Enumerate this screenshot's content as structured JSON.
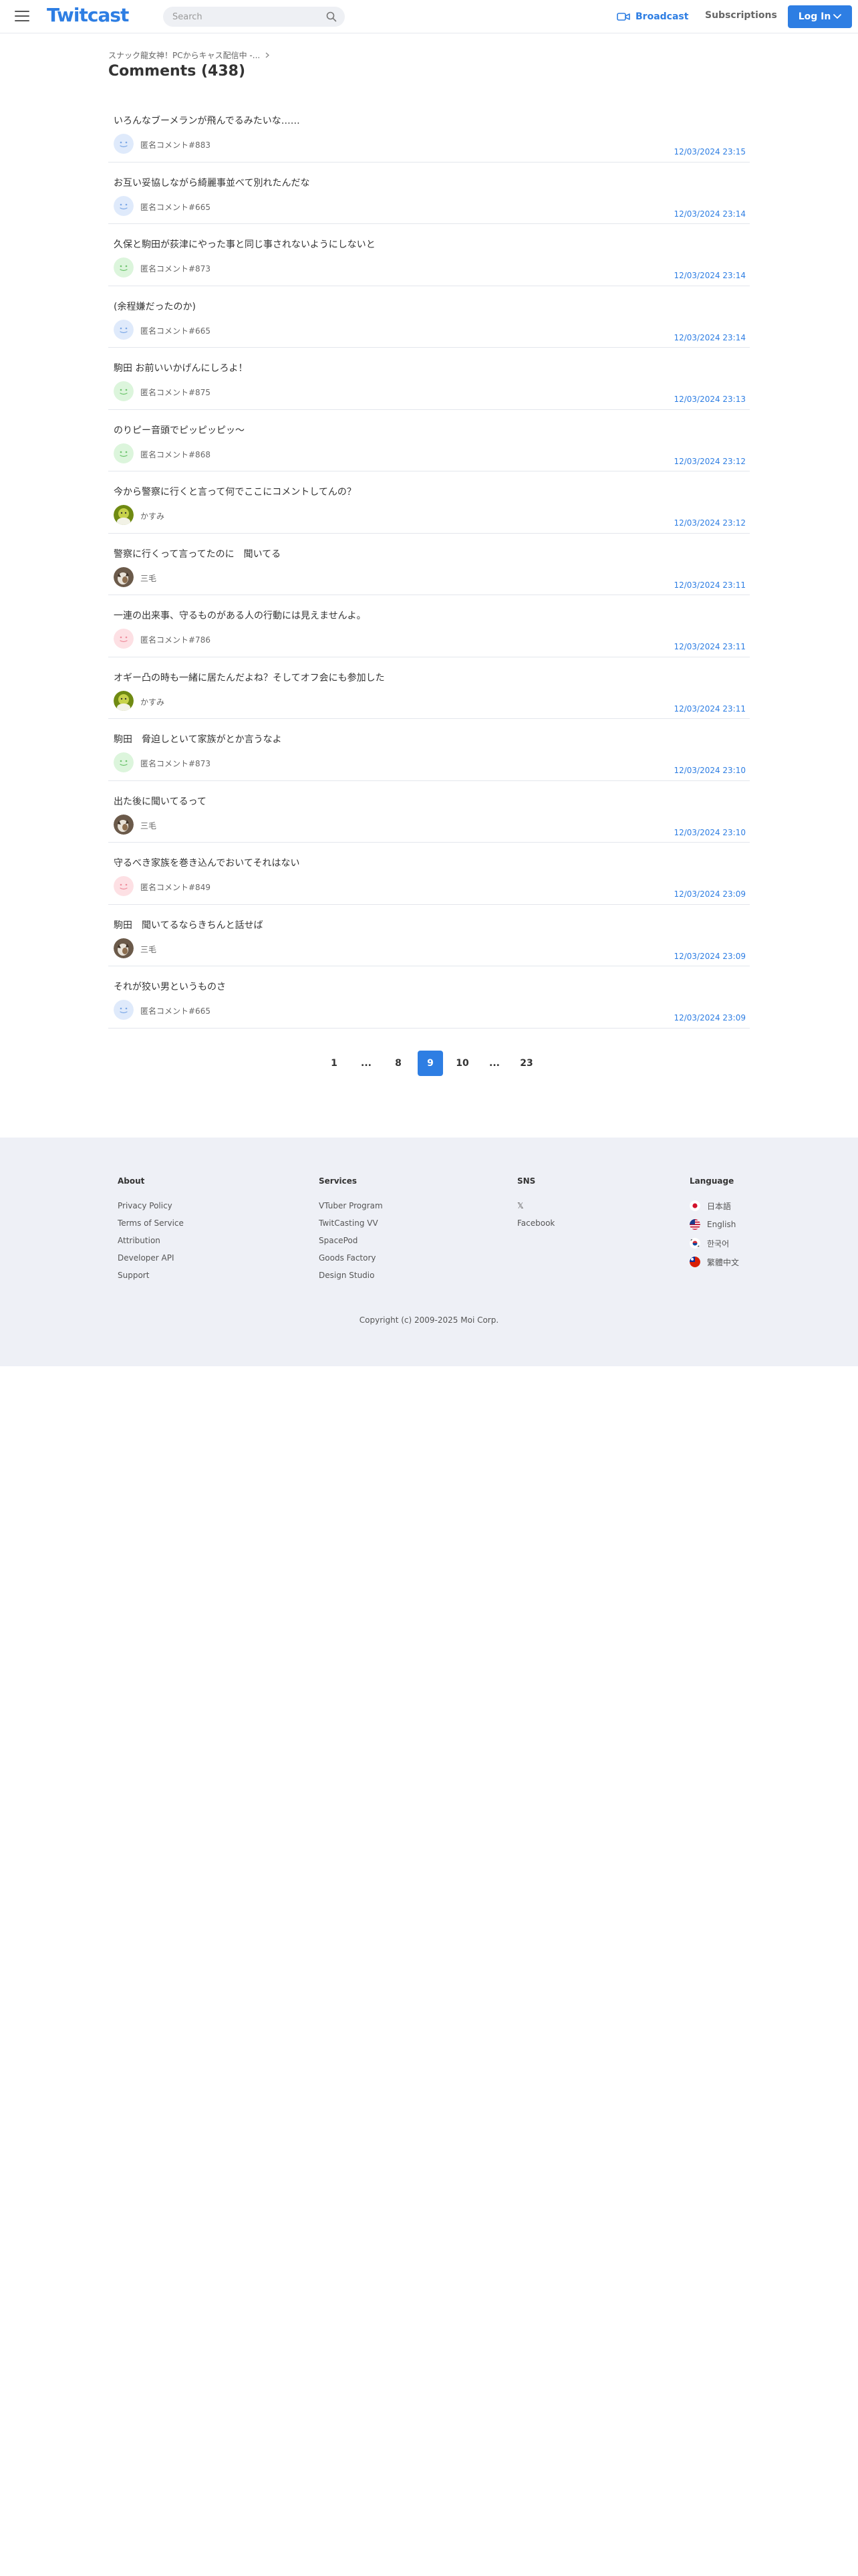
{
  "header": {
    "logo": "Twitcast",
    "search_placeholder": "Search",
    "broadcast": "Broadcast",
    "subscriptions": "Subscriptions",
    "login": "Log In"
  },
  "breadcrumb": "スナック龍女神！PCからキャス配信中 -...",
  "page_title": "Comments (438)",
  "comments": [
    {
      "text": "いろんなブーメランが飛んでるみたいな……",
      "author": "匿名コメント#883",
      "time": "12/03/2024 23:15",
      "avatar": "blue"
    },
    {
      "text": "お互い妥協しながら綺麗事並べて別れたんだな",
      "author": "匿名コメント#665",
      "time": "12/03/2024 23:14",
      "avatar": "blue"
    },
    {
      "text": "久保と駒田が荻津にやった事と同じ事されないようにしないと",
      "author": "匿名コメント#873",
      "time": "12/03/2024 23:14",
      "avatar": "green"
    },
    {
      "text": "(余程嫌だったのか)",
      "author": "匿名コメント#665",
      "time": "12/03/2024 23:14",
      "avatar": "blue"
    },
    {
      "text": "駒田 お前いいかげんにしろよ！",
      "author": "匿名コメント#875",
      "time": "12/03/2024 23:13",
      "avatar": "green"
    },
    {
      "text": "のりピー音頭でピッピッピッ〜",
      "author": "匿名コメント#868",
      "time": "12/03/2024 23:12",
      "avatar": "green"
    },
    {
      "text": "今から警察に行くと言って何でここにコメントしてんの？",
      "author": "かすみ",
      "time": "12/03/2024 23:12",
      "avatar": "photo-kasumi"
    },
    {
      "text": "警察に行くって言ってたのに　聞いてる",
      "author": "三毛",
      "time": "12/03/2024 23:11",
      "avatar": "photo-mike"
    },
    {
      "text": "一連の出来事、守るものがある人の行動には見えませんよ。",
      "author": "匿名コメント#786",
      "time": "12/03/2024 23:11",
      "avatar": "pink"
    },
    {
      "text": "オギー凸の時も一緒に居たんだよね？そしてオフ会にも参加した",
      "author": "かすみ",
      "time": "12/03/2024 23:11",
      "avatar": "photo-kasumi"
    },
    {
      "text": "駒田　脅迫しといて家族がとか言うなよ",
      "author": "匿名コメント#873",
      "time": "12/03/2024 23:10",
      "avatar": "green"
    },
    {
      "text": "出た後に聞いてるって",
      "author": "三毛",
      "time": "12/03/2024 23:10",
      "avatar": "photo-mike"
    },
    {
      "text": "守るべき家族を巻き込んでおいてそれはない",
      "author": "匿名コメント#849",
      "time": "12/03/2024 23:09",
      "avatar": "pink"
    },
    {
      "text": "駒田　聞いてるならきちんと話せば",
      "author": "三毛",
      "time": "12/03/2024 23:09",
      "avatar": "photo-mike"
    },
    {
      "text": "それが狡い男というものさ",
      "author": "匿名コメント#665",
      "time": "12/03/2024 23:09",
      "avatar": "blue"
    }
  ],
  "pagination": [
    {
      "label": "1",
      "active": false
    },
    {
      "label": "...",
      "active": false
    },
    {
      "label": "8",
      "active": false
    },
    {
      "label": "9",
      "active": true
    },
    {
      "label": "10",
      "active": false
    },
    {
      "label": "...",
      "active": false
    },
    {
      "label": "23",
      "active": false
    }
  ],
  "footer": {
    "about": {
      "title": "About",
      "links": [
        "Privacy Policy",
        "Terms of Service",
        "Attribution",
        "Developer API",
        "Support"
      ]
    },
    "services": {
      "title": "Services",
      "links": [
        "VTuber Program",
        "TwitCasting VV",
        "SpacePod",
        "Goods Factory",
        "Design Studio"
      ]
    },
    "sns": {
      "title": "SNS",
      "links": [
        "𝕏",
        "Facebook"
      ]
    },
    "language": {
      "title": "Language",
      "items": [
        {
          "label": "日本語",
          "flag": "jp"
        },
        {
          "label": "English",
          "flag": "us"
        },
        {
          "label": "한국어",
          "flag": "kr"
        },
        {
          "label": "繁體中文",
          "flag": "tw"
        }
      ]
    },
    "copyright": "Copyright (c) 2009-2025 Moi Corp."
  },
  "colors": {
    "accent": "#2e7ee3",
    "footer_bg": "#eef0f6",
    "divider": "#e3e6ec"
  }
}
